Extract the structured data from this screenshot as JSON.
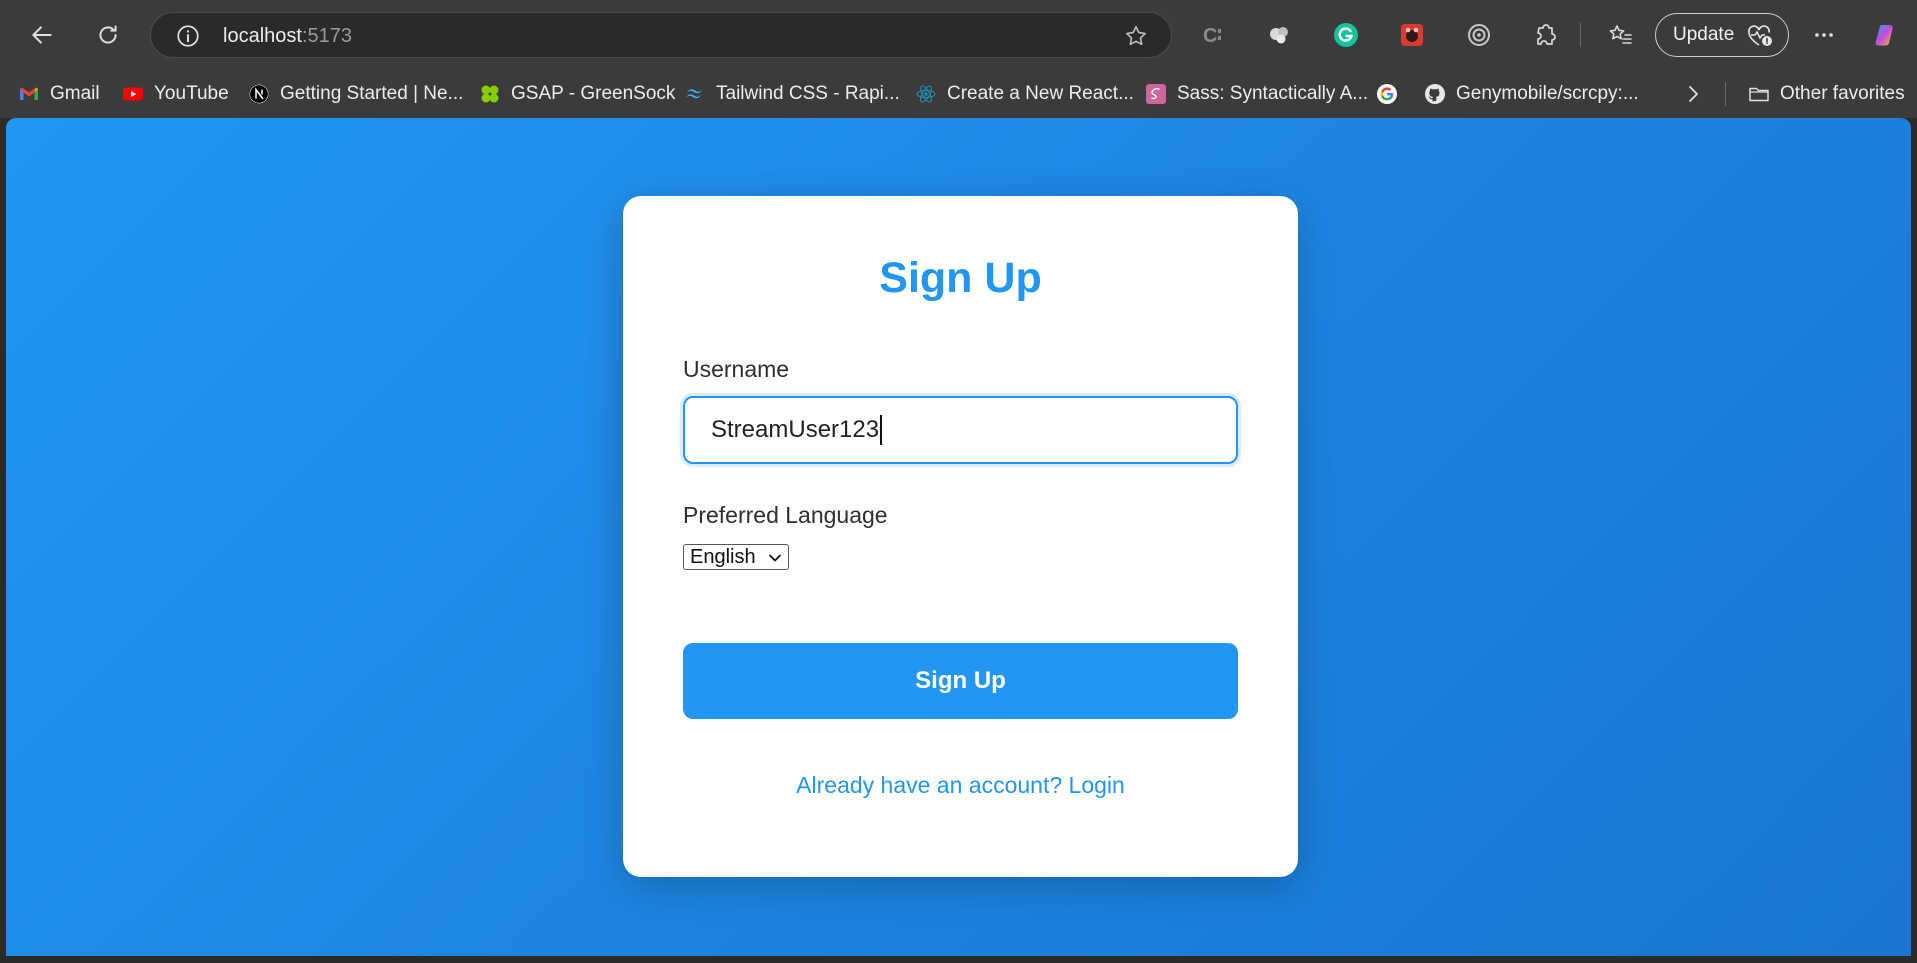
{
  "browser": {
    "url_host": "localhost",
    "url_port": ":5173",
    "update_label": "Update"
  },
  "favorites": [
    {
      "label": "Gmail",
      "icon": "gmail-icon"
    },
    {
      "label": "YouTube",
      "icon": "youtube-icon"
    },
    {
      "label": "Getting Started | Ne...",
      "icon": "nextjs-icon"
    },
    {
      "label": "GSAP - GreenSock",
      "icon": "gsap-icon"
    },
    {
      "label": "Tailwind CSS - Rapi...",
      "icon": "tailwind-icon"
    },
    {
      "label": "Create a New React...",
      "icon": "react-icon"
    },
    {
      "label": "Sass: Syntactically A...",
      "icon": "sass-icon"
    },
    {
      "label": "",
      "icon": "google-icon"
    },
    {
      "label": "Genymobile/scrcpy:...",
      "icon": "github-icon"
    },
    {
      "label": "Other favorites",
      "icon": "folder-icon"
    }
  ],
  "form": {
    "title": "Sign Up",
    "username_label": "Username",
    "username_value": "StreamUser123",
    "language_label": "Preferred Language",
    "language_value": "English",
    "submit_label": "Sign Up",
    "login_link": "Already have an account? Login"
  },
  "colors": {
    "accent": "#2196f3",
    "gradient_end": "#1976d2",
    "chrome_bg": "#3b3b3b"
  }
}
